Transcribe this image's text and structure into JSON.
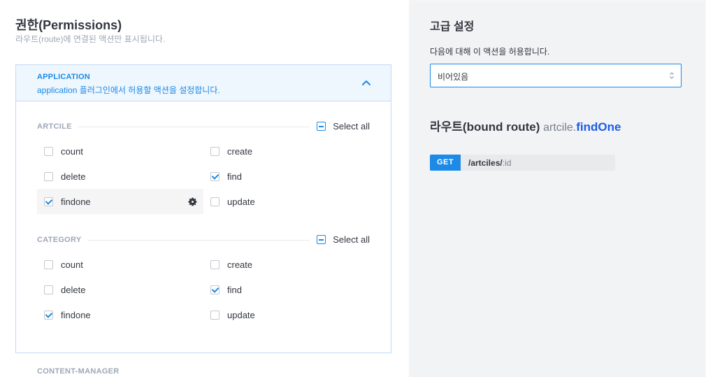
{
  "permissions": {
    "title": "권한(Permissions)",
    "subtitle": "라우트(route)에 연결된 액션만 표시됩니다.",
    "plugin": {
      "name": "APPLICATION",
      "description": "application 플러그인에서 허용할 액션을 설정합니다."
    },
    "sections": [
      {
        "label": "ARTCILE",
        "select_all": "Select all",
        "actions": [
          {
            "label": "count",
            "checked": false
          },
          {
            "label": "create",
            "checked": false
          },
          {
            "label": "delete",
            "checked": false
          },
          {
            "label": "find",
            "checked": true
          },
          {
            "label": "findone",
            "checked": true,
            "active": true
          },
          {
            "label": "update",
            "checked": false
          }
        ]
      },
      {
        "label": "CATEGORY",
        "select_all": "Select all",
        "actions": [
          {
            "label": "count",
            "checked": false
          },
          {
            "label": "create",
            "checked": false
          },
          {
            "label": "delete",
            "checked": false
          },
          {
            "label": "find",
            "checked": true
          },
          {
            "label": "findone",
            "checked": true
          },
          {
            "label": "update",
            "checked": false
          }
        ]
      }
    ],
    "next_plugin": "CONTENT-MANAGER"
  },
  "advanced": {
    "title": "고급 설정",
    "description": "다음에 대해 이 액션을 허용합니다.",
    "select_value": "비어있음",
    "route_title": "라우트(bound route)",
    "route_controller": "artcile.",
    "route_method": "findOne",
    "route": {
      "verb": "GET",
      "path": "/artciles/",
      "param": ":id"
    }
  },
  "colors": {
    "accent": "#1c8ae6",
    "method": "#1c5de7",
    "panel_bg": "#f2f3f4"
  }
}
